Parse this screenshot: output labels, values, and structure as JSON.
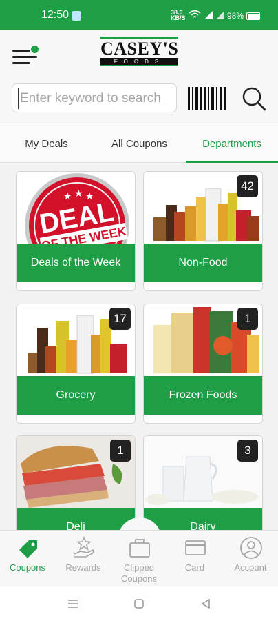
{
  "status_bar": {
    "time": "12:50",
    "speed_top": "38.0",
    "speed_bottom": "KB/S",
    "battery": "98%"
  },
  "header": {
    "logo_text": "CASEY'S",
    "logo_sub": "FOODS",
    "search_placeholder": "Enter keyword to search"
  },
  "tabs": [
    {
      "label": "My Deals"
    },
    {
      "label": "All Coupons"
    },
    {
      "label": "Departments"
    }
  ],
  "departments": [
    {
      "label": "Deals of the Week",
      "image_text": "DEAL",
      "image_text2": "OF THE WEEK"
    },
    {
      "label": "Non-Food",
      "count": "42"
    },
    {
      "label": "Grocery",
      "count": "17"
    },
    {
      "label": "Frozen Foods",
      "count": "1"
    },
    {
      "label": "Deli",
      "count": "1"
    },
    {
      "label": "Dairy",
      "count": "3"
    }
  ],
  "bottom_nav": [
    {
      "label": "Coupons"
    },
    {
      "label": "Rewards"
    },
    {
      "label": "Clipped Coupons"
    },
    {
      "label": "Card"
    },
    {
      "label": "Account"
    }
  ],
  "colors": {
    "brand_green": "#1e9e45",
    "badge": "#222222"
  }
}
